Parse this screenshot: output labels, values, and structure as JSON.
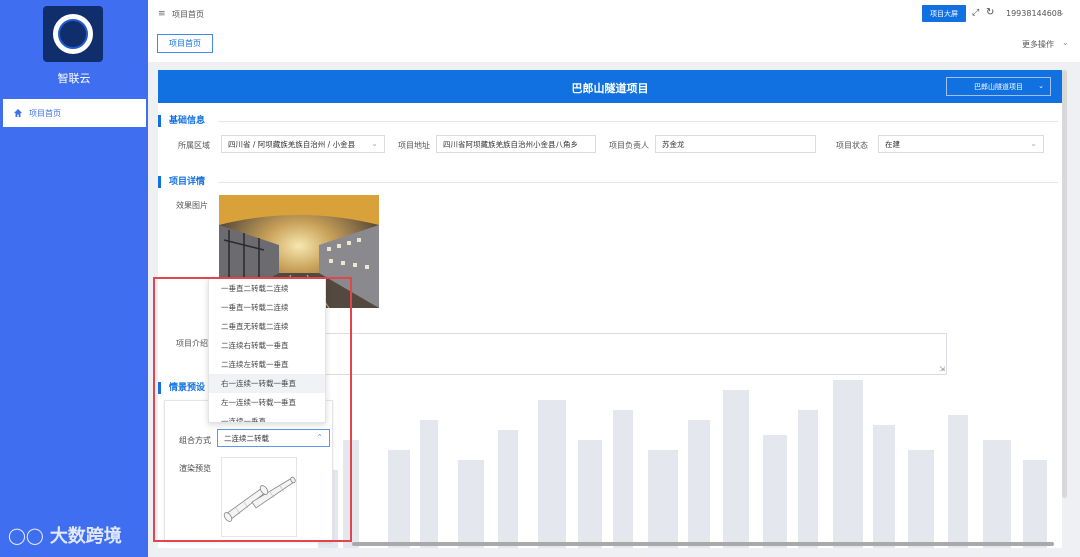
{
  "sidebar": {
    "brand": "智联云",
    "nav": [
      {
        "label": "项目首页",
        "icon": "home-icon",
        "active": true
      }
    ],
    "watermark": "大数跨境"
  },
  "topbar": {
    "breadcrumb": "项目首页",
    "screen_button": "项目大屏",
    "user": "19938144608"
  },
  "tabs": [
    {
      "label": "项目首页",
      "active": true
    }
  ],
  "more_actions": "更多操作",
  "project": {
    "title": "巴郎山隧道项目",
    "selector_value": "巴郎山隧道项目"
  },
  "basic_info": {
    "title": "基础信息",
    "region_label": "所属区域",
    "region_value": "四川省 / 阿坝藏族羌族自治州 / 小金县",
    "address_label": "项目地址",
    "address_value": "四川省阿坝藏族羌族自治州小金县八角乡",
    "manager_label": "项目负责人",
    "manager_value": "苏金龙",
    "status_label": "项目状态",
    "status_value": "在建"
  },
  "details": {
    "title": "项目详情",
    "image_label": "效果图片",
    "intro_label": "项目介绍"
  },
  "preset": {
    "title": "情景预设",
    "combo_label": "组合方式",
    "combo_value": "二连续二转载",
    "render_label": "渲染预览",
    "options": [
      "一垂直二转载二连续",
      "一垂直一转载二连续",
      "二垂直无转载二连续",
      "二连续右转载一垂直",
      "二连续左转载一垂直",
      "右一连续一转载一垂直",
      "左一连续一转载一垂直",
      "一连续一垂直"
    ],
    "hovered_index": 5
  },
  "colors": {
    "sidebar": "#3f6ff0",
    "accent": "#1271e0",
    "highlight": "#e0464b"
  }
}
